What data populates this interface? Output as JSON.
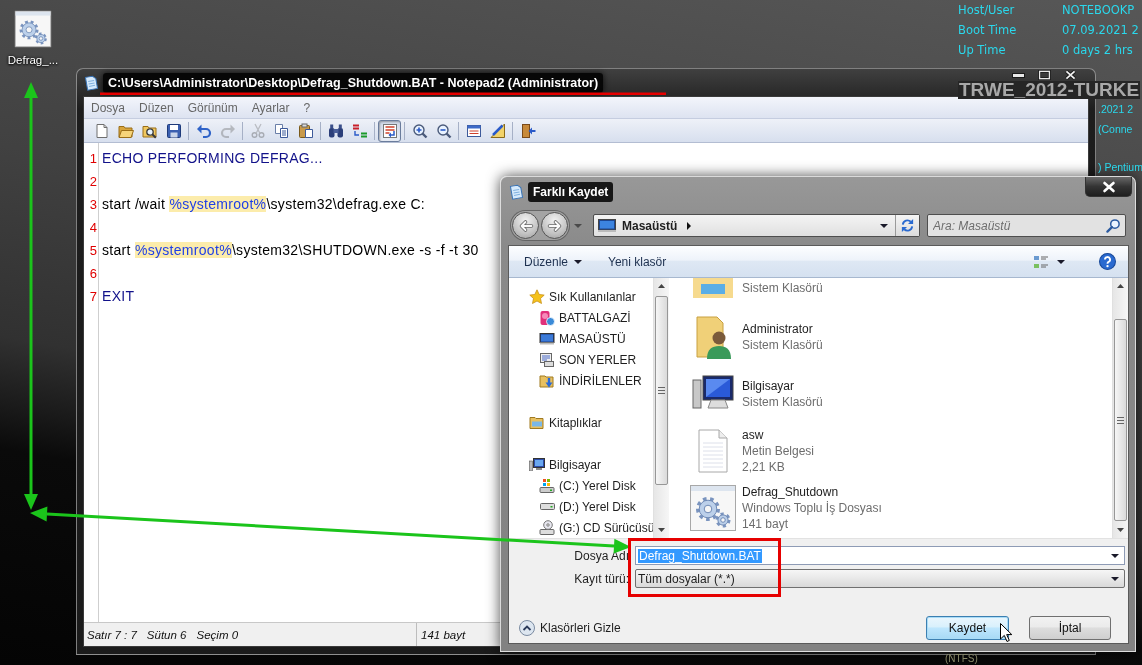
{
  "desktop": {
    "icons": [
      {
        "label": "Defrag_..."
      }
    ]
  },
  "widget": {
    "rows": [
      {
        "label": "Host/User",
        "value": "NOTEBOOKP"
      },
      {
        "label": "Boot Time",
        "value": "07.09.2021 2"
      },
      {
        "label": "Up Time",
        "value": "0 days 2 hrs"
      }
    ],
    "machine_name": "TRWE_2012-TURKE",
    "fragments": [
      ".2021 2",
      "(Conne",
      ") Pentium"
    ],
    "disk_label": "(NTFS)"
  },
  "notepad": {
    "title": "C:\\Users\\Administrator\\Desktop\\Defrag_Shutdown.BAT - Notepad2 (Administrator)",
    "menu": [
      "Dosya",
      "Düzen",
      "Görünüm",
      "Ayarlar",
      "?"
    ],
    "toolbar_groups": [
      {
        "tools": [
          {
            "kind": "new",
            "disabled": false,
            "pressed": false
          },
          {
            "kind": "open",
            "disabled": false,
            "pressed": false
          },
          {
            "kind": "browse",
            "disabled": false,
            "pressed": false
          },
          {
            "kind": "save",
            "disabled": false,
            "pressed": false
          }
        ]
      },
      {
        "tools": [
          {
            "kind": "undo",
            "disabled": false,
            "pressed": false
          },
          {
            "kind": "redo",
            "disabled": true,
            "pressed": false
          }
        ]
      },
      {
        "tools": [
          {
            "kind": "cut",
            "disabled": true,
            "pressed": false
          },
          {
            "kind": "copy",
            "disabled": false,
            "pressed": false
          },
          {
            "kind": "paste",
            "disabled": false,
            "pressed": false
          }
        ]
      },
      {
        "tools": [
          {
            "kind": "find",
            "disabled": false,
            "pressed": false
          },
          {
            "kind": "replace",
            "disabled": false,
            "pressed": false
          }
        ]
      },
      {
        "tools": [
          {
            "kind": "word-wrap",
            "disabled": false,
            "pressed": true
          }
        ]
      },
      {
        "tools": [
          {
            "kind": "zoom-in",
            "disabled": false,
            "pressed": false
          },
          {
            "kind": "zoom-out",
            "disabled": false,
            "pressed": false
          }
        ]
      },
      {
        "tools": [
          {
            "kind": "scheme",
            "disabled": false,
            "pressed": false
          },
          {
            "kind": "customize",
            "disabled": false,
            "pressed": false
          }
        ]
      },
      {
        "tools": [
          {
            "kind": "exit",
            "disabled": false,
            "pressed": false
          }
        ]
      }
    ],
    "lines": [
      {
        "number": "1",
        "tokens": [
          {
            "kind": "command",
            "text": "ECHO PERFORMING DEFRAG..."
          }
        ]
      },
      {
        "number": "2"
      },
      {
        "number": "3",
        "tokens": [
          {
            "kind": "plain",
            "text": "start /wait "
          },
          {
            "kind": "variable",
            "text": "%systemroot%"
          },
          {
            "kind": "plain",
            "text": "\\system32\\defrag.exe C:"
          }
        ]
      },
      {
        "number": "4"
      },
      {
        "number": "5",
        "tokens": [
          {
            "kind": "plain",
            "text": "start "
          },
          {
            "kind": "variable",
            "text": "%systemroot%"
          },
          {
            "kind": "plain",
            "text": "\\system32\\SHUTDOWN.exe -s -f -t 30"
          }
        ]
      },
      {
        "number": "6"
      },
      {
        "number": "7",
        "tokens": [
          {
            "kind": "command",
            "text": "EXIT"
          }
        ]
      }
    ],
    "status_bar": {
      "position": [
        "Satır 7 : 7",
        "Sütun 6",
        "Seçim 0"
      ],
      "size": "141 bayt"
    }
  },
  "save_dialog": {
    "title": "Farklı Kaydet",
    "location": "Masaüstü",
    "search": {
      "placeholder": "Ara: Masaüstü"
    },
    "commands": [
      {
        "label": "Düzenle",
        "dropdown": true
      },
      {
        "label": "Yeni klasör",
        "dropdown": false
      }
    ],
    "navigation": [
      {
        "kind": "favorites",
        "label": "Sık Kullanılanlar",
        "children": [
          {
            "kind": "user",
            "label": "BATTALGAZİ"
          },
          {
            "kind": "desktop",
            "label": "MASAÜSTÜ"
          },
          {
            "kind": "recent",
            "label": "SON YERLER"
          },
          {
            "kind": "downloads",
            "label": "İNDİRİLENLER"
          }
        ]
      },
      {
        "kind": "libraries",
        "label": "Kitaplıklar"
      },
      {
        "kind": "computer",
        "label": "Bilgisayar",
        "children": [
          {
            "kind": "system-drive",
            "label": "(C:) Yerel Disk"
          },
          {
            "kind": "drive",
            "label": "(D:) Yerel Disk"
          },
          {
            "kind": "cd-drive",
            "label": "(G:) CD Sürücüsü"
          }
        ]
      }
    ],
    "files": [
      {
        "kind": "folder",
        "details": [
          "Sistem Klasörü"
        ]
      },
      {
        "kind": "user-folder",
        "name": "Administrator",
        "details": [
          "Sistem Klasörü"
        ]
      },
      {
        "kind": "computer",
        "name": "Bilgisayar",
        "details": [
          "Sistem Klasörü"
        ]
      },
      {
        "kind": "text",
        "name": "asw",
        "details": [
          "Metin Belgesi",
          "2,21 KB"
        ]
      },
      {
        "kind": "batch",
        "name": "Defrag_Shutdown",
        "details": [
          "Windows Toplu İş Dosyası",
          "141 bayt"
        ]
      }
    ],
    "file_name": {
      "label": "Dosya Adı",
      "value": "Defrag_Shutdown.BAT",
      "selected": true
    },
    "file_type": {
      "label": "Kayıt türü:",
      "value": "Tüm dosyalar (*.*)"
    },
    "hide_folders": "Klasörleri Gizle",
    "buttons": [
      {
        "kind": "default",
        "label": "Kaydet"
      },
      {
        "kind": "normal",
        "label": "İptal"
      }
    ]
  },
  "annotations": [
    {
      "kind": "underline"
    },
    {
      "kind": "double-arrow"
    },
    {
      "kind": "arrow"
    },
    {
      "kind": "frame"
    }
  ]
}
